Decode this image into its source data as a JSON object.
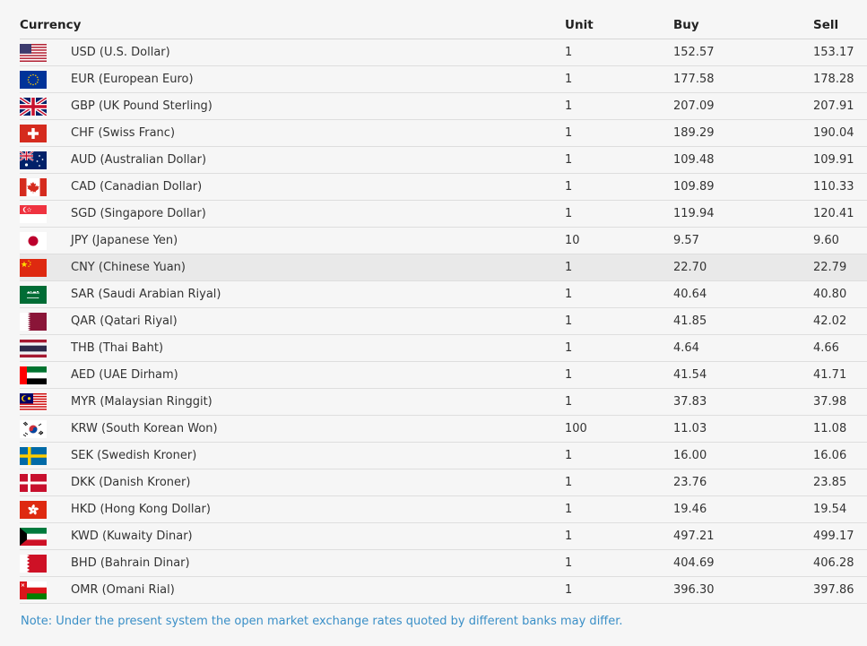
{
  "table": {
    "headers": {
      "currency": "Currency",
      "unit": "Unit",
      "buy": "Buy",
      "sell": "Sell"
    },
    "rows": [
      {
        "code": "USD",
        "name": "USD (U.S. Dollar)",
        "unit": "1",
        "buy": "152.57",
        "sell": "153.17",
        "flag_icon": "us-flag-icon"
      },
      {
        "code": "EUR",
        "name": "EUR (European Euro)",
        "unit": "1",
        "buy": "177.58",
        "sell": "178.28",
        "flag_icon": "eu-flag-icon"
      },
      {
        "code": "GBP",
        "name": "GBP (UK Pound Sterling)",
        "unit": "1",
        "buy": "207.09",
        "sell": "207.91",
        "flag_icon": "uk-flag-icon"
      },
      {
        "code": "CHF",
        "name": "CHF (Swiss Franc)",
        "unit": "1",
        "buy": "189.29",
        "sell": "190.04",
        "flag_icon": "swiss-flag-icon"
      },
      {
        "code": "AUD",
        "name": "AUD (Australian Dollar)",
        "unit": "1",
        "buy": "109.48",
        "sell": "109.91",
        "flag_icon": "australia-flag-icon"
      },
      {
        "code": "CAD",
        "name": "CAD (Canadian Dollar)",
        "unit": "1",
        "buy": "109.89",
        "sell": "110.33",
        "flag_icon": "canada-flag-icon"
      },
      {
        "code": "SGD",
        "name": "SGD (Singapore Dollar)",
        "unit": "1",
        "buy": "119.94",
        "sell": "120.41",
        "flag_icon": "singapore-flag-icon"
      },
      {
        "code": "JPY",
        "name": "JPY (Japanese Yen)",
        "unit": "10",
        "buy": "9.57",
        "sell": "9.60",
        "flag_icon": "japan-flag-icon"
      },
      {
        "code": "CNY",
        "name": "CNY (Chinese Yuan)",
        "unit": "1",
        "buy": "22.70",
        "sell": "22.79",
        "flag_icon": "china-flag-icon",
        "highlighted": true
      },
      {
        "code": "SAR",
        "name": "SAR (Saudi Arabian Riyal)",
        "unit": "1",
        "buy": "40.64",
        "sell": "40.80",
        "flag_icon": "saudi-arabia-flag-icon"
      },
      {
        "code": "QAR",
        "name": "QAR (Qatari Riyal)",
        "unit": "1",
        "buy": "41.85",
        "sell": "42.02",
        "flag_icon": "qatar-flag-icon"
      },
      {
        "code": "THB",
        "name": "THB (Thai Baht)",
        "unit": "1",
        "buy": "4.64",
        "sell": "4.66",
        "flag_icon": "thailand-flag-icon"
      },
      {
        "code": "AED",
        "name": "AED (UAE Dirham)",
        "unit": "1",
        "buy": "41.54",
        "sell": "41.71",
        "flag_icon": "uae-flag-icon"
      },
      {
        "code": "MYR",
        "name": "MYR (Malaysian Ringgit)",
        "unit": "1",
        "buy": "37.83",
        "sell": "37.98",
        "flag_icon": "malaysia-flag-icon"
      },
      {
        "code": "KRW",
        "name": "KRW (South Korean Won)",
        "unit": "100",
        "buy": "11.03",
        "sell": "11.08",
        "flag_icon": "south-korea-flag-icon"
      },
      {
        "code": "SEK",
        "name": "SEK (Swedish Kroner)",
        "unit": "1",
        "buy": "16.00",
        "sell": "16.06",
        "flag_icon": "sweden-flag-icon"
      },
      {
        "code": "DKK",
        "name": "DKK (Danish Kroner)",
        "unit": "1",
        "buy": "23.76",
        "sell": "23.85",
        "flag_icon": "denmark-flag-icon"
      },
      {
        "code": "HKD",
        "name": "HKD (Hong Kong Dollar)",
        "unit": "1",
        "buy": "19.46",
        "sell": "19.54",
        "flag_icon": "hong-kong-flag-icon"
      },
      {
        "code": "KWD",
        "name": "KWD (Kuwaity Dinar)",
        "unit": "1",
        "buy": "497.21",
        "sell": "499.17",
        "flag_icon": "kuwait-flag-icon"
      },
      {
        "code": "BHD",
        "name": "BHD (Bahrain Dinar)",
        "unit": "1",
        "buy": "404.69",
        "sell": "406.28",
        "flag_icon": "bahrain-flag-icon"
      },
      {
        "code": "OMR",
        "name": "OMR (Omani Rial)",
        "unit": "1",
        "buy": "396.30",
        "sell": "397.86",
        "flag_icon": "oman-flag-icon"
      }
    ]
  },
  "note": "Note: Under the present system the open market exchange rates quoted by different banks may differ.",
  "colors": {
    "note": "#3a8fc7",
    "highlight_row": "#e9e9e9",
    "background": "#f6f6f6"
  }
}
